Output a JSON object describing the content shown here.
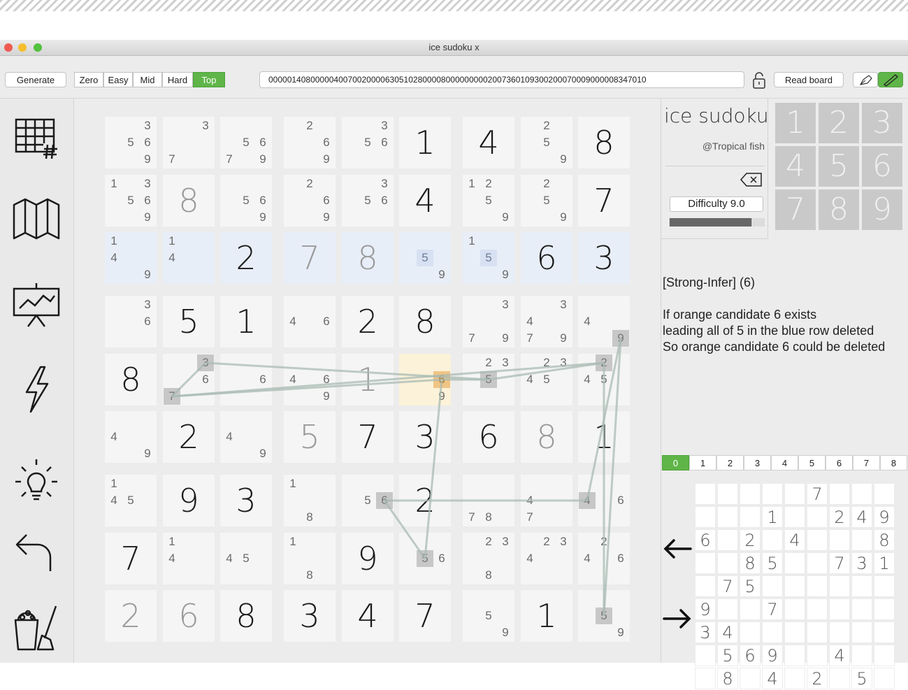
{
  "window": {
    "title": "ice sudoku x"
  },
  "toolbar": {
    "generate": "Generate",
    "difficulties": [
      "Zero",
      "Easy",
      "Mid",
      "Hard",
      "Top"
    ],
    "active_difficulty": "Top",
    "puzzle_string": "000001408000004007002000063051028000080000000002007360109300200070009000008347010",
    "read_board": "Read board"
  },
  "sidebar": {
    "icons": [
      "sudoku-grid-icon",
      "map-icon",
      "presentation-chart-icon",
      "lightning-icon",
      "lightbulb-icon",
      "undo-icon",
      "clear-board-icon"
    ]
  },
  "board": {
    "cells": [
      [
        {
          "c": [
            3,
            5,
            6,
            9
          ]
        },
        {
          "c": [
            3,
            7
          ]
        },
        {
          "c": [
            5,
            6,
            7,
            9
          ]
        },
        {
          "c": [
            2,
            6,
            9
          ]
        },
        {
          "c": [
            3,
            5,
            6
          ]
        },
        {
          "v": "1",
          "t": "given"
        },
        {
          "v": "4",
          "t": "given"
        },
        {
          "c": [
            2,
            5,
            9
          ]
        },
        {
          "v": "8",
          "t": "given"
        }
      ],
      [
        {
          "c": [
            1,
            3,
            5,
            6,
            9
          ]
        },
        {
          "v": "8",
          "t": "filled"
        },
        {
          "c": [
            5,
            6,
            9
          ]
        },
        {
          "c": [
            2,
            6,
            9
          ]
        },
        {
          "c": [
            3,
            5,
            6
          ]
        },
        {
          "v": "4",
          "t": "given"
        },
        {
          "c": [
            1,
            2,
            5,
            9
          ]
        },
        {
          "c": [
            2,
            5,
            9
          ]
        },
        {
          "v": "7",
          "t": "given"
        }
      ],
      [
        {
          "c": [
            1,
            4,
            9
          ],
          "bg": "blue"
        },
        {
          "c": [
            1,
            4
          ],
          "bg": "blue"
        },
        {
          "v": "2",
          "t": "given",
          "bg": "blue"
        },
        {
          "v": "7",
          "t": "filled",
          "bg": "blue"
        },
        {
          "v": "8",
          "t": "filled",
          "bg": "blue"
        },
        {
          "c": [
            5,
            9
          ],
          "bg": "blue",
          "blue": [
            5
          ]
        },
        {
          "c": [
            1,
            5,
            9
          ],
          "bg": "blue",
          "blue": [
            5
          ]
        },
        {
          "v": "6",
          "t": "given",
          "bg": "blue"
        },
        {
          "v": "3",
          "t": "given",
          "bg": "blue"
        }
      ],
      [
        {
          "c": [
            3,
            6
          ]
        },
        {
          "v": "5",
          "t": "given"
        },
        {
          "v": "1",
          "t": "given"
        },
        {
          "c": [
            4,
            6
          ]
        },
        {
          "v": "2",
          "t": "given"
        },
        {
          "v": "8",
          "t": "given"
        },
        {
          "c": [
            3,
            7,
            9
          ]
        },
        {
          "c": [
            3,
            4,
            7,
            9
          ]
        },
        {
          "c": [
            4,
            9
          ],
          "hl": [
            9
          ]
        }
      ],
      [
        {
          "v": "8",
          "t": "given"
        },
        {
          "c": [
            3,
            6,
            7
          ],
          "hl": [
            3,
            7
          ]
        },
        {
          "c": [
            6
          ]
        },
        {
          "c": [
            4,
            6,
            9
          ]
        },
        {
          "v": "1",
          "t": "filled"
        },
        {
          "c": [
            6,
            9
          ],
          "bg": "yellow",
          "orange": [
            6
          ]
        },
        {
          "c": [
            2,
            3,
            5
          ],
          "hl": [
            5
          ]
        },
        {
          "c": [
            2,
            3,
            4,
            5
          ]
        },
        {
          "c": [
            2,
            4,
            5
          ],
          "hl": [
            2
          ]
        }
      ],
      [
        {
          "c": [
            4,
            9
          ]
        },
        {
          "v": "2",
          "t": "given"
        },
        {
          "c": [
            4,
            9
          ]
        },
        {
          "v": "5",
          "t": "filled"
        },
        {
          "v": "7",
          "t": "given"
        },
        {
          "v": "3",
          "t": "given"
        },
        {
          "v": "6",
          "t": "given"
        },
        {
          "v": "8",
          "t": "filled"
        },
        {
          "v": "1",
          "t": "given"
        }
      ],
      [
        {
          "c": [
            1,
            4,
            5
          ]
        },
        {
          "v": "9",
          "t": "given"
        },
        {
          "v": "3",
          "t": "given"
        },
        {
          "c": [
            1,
            8
          ]
        },
        {
          "c": [
            5,
            6
          ],
          "hl": [
            6
          ]
        },
        {
          "v": "2",
          "t": "given"
        },
        {
          "c": [
            7,
            8
          ]
        },
        {
          "c": [
            4,
            7
          ]
        },
        {
          "c": [
            4,
            6
          ],
          "hl": [
            4
          ]
        }
      ],
      [
        {
          "v": "7",
          "t": "given"
        },
        {
          "c": [
            1,
            4
          ]
        },
        {
          "c": [
            4,
            5
          ]
        },
        {
          "c": [
            1,
            8
          ]
        },
        {
          "v": "9",
          "t": "given"
        },
        {
          "c": [
            5,
            6
          ],
          "hl": [
            5
          ]
        },
        {
          "c": [
            2,
            3,
            8
          ]
        },
        {
          "c": [
            2,
            3,
            4
          ]
        },
        {
          "c": [
            2,
            4,
            6
          ]
        }
      ],
      [
        {
          "v": "2",
          "t": "filled"
        },
        {
          "v": "6",
          "t": "filled"
        },
        {
          "v": "8",
          "t": "given"
        },
        {
          "v": "3",
          "t": "given"
        },
        {
          "v": "4",
          "t": "given"
        },
        {
          "v": "7",
          "t": "given"
        },
        {
          "c": [
            5,
            9
          ]
        },
        {
          "v": "1",
          "t": "given"
        },
        {
          "c": [
            5,
            9
          ],
          "hl": [
            5
          ]
        }
      ]
    ]
  },
  "info": {
    "app_name": "ice sudoku",
    "author": "@Tropical fish",
    "difficulty": "Difficulty 9.0",
    "difficulty_level": 0.86,
    "hint_title": "[Strong-Infer] (6)",
    "hint_lines": [
      "If orange candidate 6 exists",
      "leading all of 5 in the blue row deleted",
      "So orange candidate 6 could be deleted"
    ],
    "numpad": [
      "1",
      "2",
      "3",
      "4",
      "5",
      "6",
      "7",
      "8",
      "9"
    ],
    "tabs": [
      "0",
      "1",
      "2",
      "3",
      "4",
      "5",
      "6",
      "7",
      "8"
    ],
    "active_tab": "0",
    "prev_icon": "left-arrow-icon",
    "next_icon": "right-arrow-icon",
    "mini_grid": [
      [
        "",
        "",
        "",
        "",
        "",
        "7",
        "",
        "",
        ""
      ],
      [
        "",
        "",
        "",
        "1",
        "",
        "",
        "2",
        "4",
        "9"
      ],
      [
        "6",
        "",
        "2",
        "",
        "4",
        "",
        "",
        "",
        "8"
      ],
      [
        "",
        "",
        "8",
        "5",
        "",
        "",
        "7",
        "3",
        "1"
      ],
      [
        "",
        "7",
        "5",
        "",
        "",
        "",
        "",
        "",
        ""
      ],
      [
        "9",
        "",
        "",
        "7",
        "",
        "",
        "",
        "",
        ""
      ],
      [
        "3",
        "4",
        "",
        "",
        "",
        "",
        "",
        "",
        ""
      ],
      [
        "",
        "5",
        "6",
        "9",
        "",
        "",
        "4",
        "",
        ""
      ],
      [
        "",
        "8",
        "",
        "4",
        "",
        "2",
        "",
        "5",
        ""
      ]
    ]
  },
  "colors": {
    "accent_green": "#5fb548",
    "blue_row": "#e8eef8",
    "orange_candidate": "#f0c485",
    "highlight_gray": "#c7c7c7"
  }
}
